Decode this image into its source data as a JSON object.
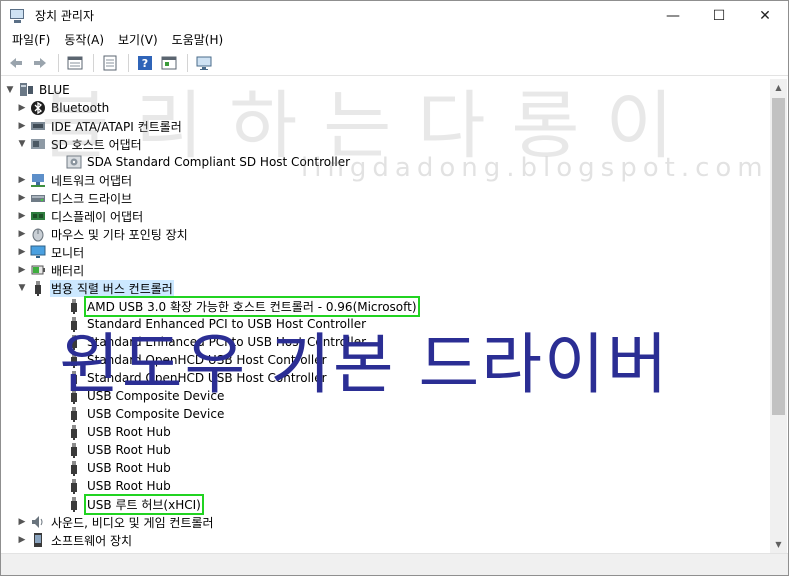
{
  "window": {
    "title": "장치 관리자",
    "controls": {
      "minimize": "—",
      "maximize": "☐",
      "close": "✕"
    }
  },
  "menu": [
    "파일(F)",
    "동작(A)",
    "보기(V)",
    "도움말(H)"
  ],
  "toolbar": [
    "back-icon",
    "forward-icon",
    "properties-list-icon",
    "view-icon",
    "help-icon",
    "action-icon",
    "monitor-icon"
  ],
  "tree": {
    "root": "BLUE",
    "items": [
      {
        "label": "Bluetooth",
        "level": 1,
        "expander": "collapsed",
        "icon": "bluetooth-icon"
      },
      {
        "label": "IDE ATA/ATAPI 컨트롤러",
        "level": 1,
        "expander": "collapsed",
        "icon": "ide-controller-icon"
      },
      {
        "label": "SD 호스트 어댑터",
        "level": 1,
        "expander": "expanded",
        "icon": "sd-adapter-icon"
      },
      {
        "label": "SDA Standard Compliant SD Host Controller",
        "level": 2,
        "expander": "none",
        "icon": "sd-device-icon"
      },
      {
        "label": "네트워크 어댑터",
        "level": 1,
        "expander": "collapsed",
        "icon": "network-icon"
      },
      {
        "label": "디스크 드라이브",
        "level": 1,
        "expander": "collapsed",
        "icon": "disk-icon"
      },
      {
        "label": "디스플레이 어댑터",
        "level": 1,
        "expander": "collapsed",
        "icon": "display-adapter-icon"
      },
      {
        "label": "마우스 및 기타 포인팅 장치",
        "level": 1,
        "expander": "collapsed",
        "icon": "mouse-icon"
      },
      {
        "label": "모니터",
        "level": 1,
        "expander": "collapsed",
        "icon": "monitor-icon"
      },
      {
        "label": "배터리",
        "level": 1,
        "expander": "collapsed",
        "icon": "battery-icon"
      },
      {
        "label": "범용 직렬 버스 컨트롤러",
        "level": 1,
        "expander": "expanded",
        "icon": "usb-icon",
        "selected": true
      },
      {
        "label": "AMD USB 3.0 확장 가능한 호스트 컨트롤러 - 0.96(Microsoft)",
        "level": 2,
        "expander": "none",
        "icon": "usb-icon",
        "highlight": true
      },
      {
        "label": "Standard Enhanced PCI to USB Host Controller",
        "level": 2,
        "expander": "none",
        "icon": "usb-icon"
      },
      {
        "label": "Standard Enhanced PCI to USB Host Controller",
        "level": 2,
        "expander": "none",
        "icon": "usb-icon"
      },
      {
        "label": "Standard OpenHCD USB Host Controller",
        "level": 2,
        "expander": "none",
        "icon": "usb-icon"
      },
      {
        "label": "Standard OpenHCD USB Host Controller",
        "level": 2,
        "expander": "none",
        "icon": "usb-icon"
      },
      {
        "label": "USB Composite Device",
        "level": 2,
        "expander": "none",
        "icon": "usb-icon"
      },
      {
        "label": "USB Composite Device",
        "level": 2,
        "expander": "none",
        "icon": "usb-icon"
      },
      {
        "label": "USB Root Hub",
        "level": 2,
        "expander": "none",
        "icon": "usb-icon"
      },
      {
        "label": "USB Root Hub",
        "level": 2,
        "expander": "none",
        "icon": "usb-icon"
      },
      {
        "label": "USB Root Hub",
        "level": 2,
        "expander": "none",
        "icon": "usb-icon"
      },
      {
        "label": "USB Root Hub",
        "level": 2,
        "expander": "none",
        "icon": "usb-icon"
      },
      {
        "label": "USB 루트 허브(xHCI)",
        "level": 2,
        "expander": "none",
        "icon": "usb-icon",
        "highlight": true
      },
      {
        "label": "사운드, 비디오 및 게임 컨트롤러",
        "level": 1,
        "expander": "collapsed",
        "icon": "sound-icon"
      },
      {
        "label": "소프트웨어 장치",
        "level": 1,
        "expander": "collapsed",
        "icon": "software-device-icon"
      }
    ]
  },
  "overlay": {
    "watermark": "블리하는다롱이",
    "watermark_url": "lingdadong.blogspot.com",
    "caption": "윈도우 기본  드라이버"
  },
  "colors": {
    "highlight_box": "#21d321",
    "selection": "#cce8ff",
    "caption": "#2b2e94"
  }
}
